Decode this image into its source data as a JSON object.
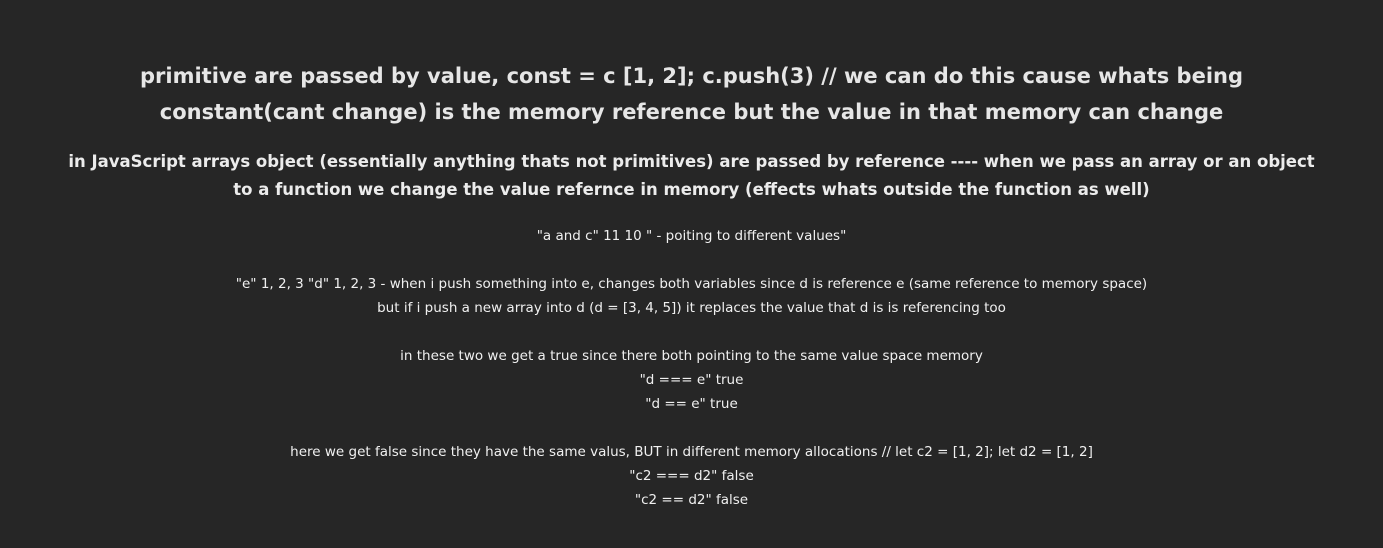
{
  "heading_main": "primitive are passed by value, const = c [1, 2]; c.push(3) // we can do this cause whats being constant(cant change) is the memory reference but the value in that memory can change",
  "heading_sub": "in JavaScript arrays object (essentially anything thats not primitives) are passed by reference ---- when we pass an array or an object to a function we change the value refernce in memory (effects whats outside the function as well)",
  "lines": [
    "\"a and c\" 11 10 \" - poiting to different values\"",
    "\"e\" 1, 2, 3 \"d\" 1, 2, 3 - when i push something into e, changes both variables since d is reference e (same reference to memory space)",
    "but if i push a new array into d (d = [3, 4, 5]) it replaces the value that d is is referencing too",
    "in these two we get a true since there both pointing to the same value space memory",
    "\"d === e\" true",
    "\"d == e\" true",
    "here we get false since they have the same valus, BUT in different memory allocations // let c2 = [1, 2]; let d2 = [1, 2]",
    "\"c2 === d2\" false",
    "\"c2 == d2\" false"
  ]
}
